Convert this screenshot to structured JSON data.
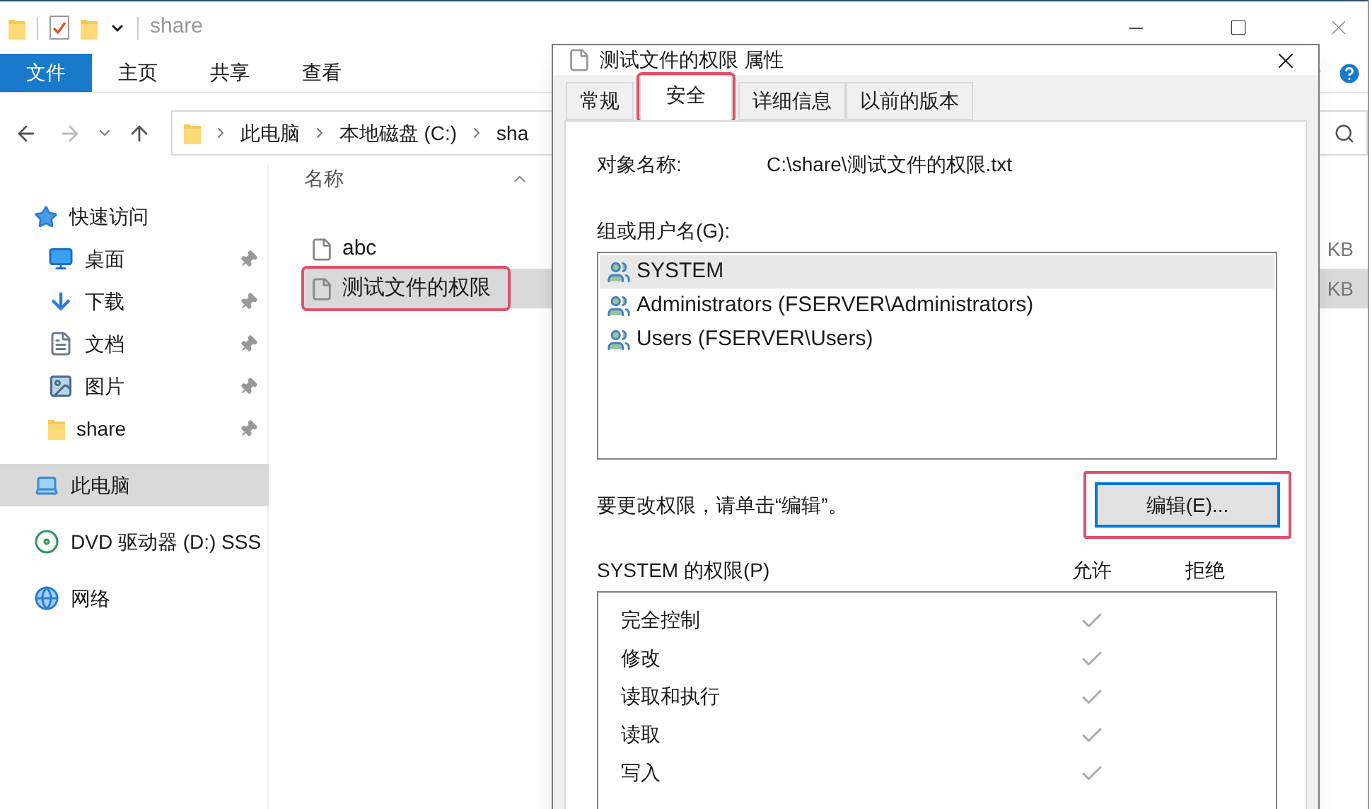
{
  "explorer": {
    "title": "share",
    "ribbon_tabs": [
      {
        "label": "文件",
        "selected": true
      },
      {
        "label": "主页",
        "selected": false
      },
      {
        "label": "共享",
        "selected": false
      },
      {
        "label": "查看",
        "selected": false
      }
    ],
    "breadcrumb": [
      "此电脑",
      "本地磁盘 (C:)",
      "sha"
    ],
    "sidebar": [
      {
        "label": "快速访问",
        "selected": false,
        "pinned": false,
        "children": [
          {
            "label": "桌面",
            "selected": false,
            "pinned": true
          },
          {
            "label": "下载",
            "selected": false,
            "pinned": true
          },
          {
            "label": "文档",
            "selected": false,
            "pinned": true
          },
          {
            "label": "图片",
            "selected": false,
            "pinned": true
          },
          {
            "label": "share",
            "selected": false,
            "pinned": true
          }
        ]
      },
      {
        "label": "此电脑",
        "selected": true,
        "pinned": false
      },
      {
        "label": "DVD 驱动器 (D:) SSS",
        "selected": false,
        "pinned": false
      },
      {
        "label": "网络",
        "selected": false,
        "pinned": false
      }
    ],
    "column_header": "名称",
    "files": [
      {
        "name": "abc",
        "size": "KB",
        "selected": false,
        "highlighted": false
      },
      {
        "name": "测试文件的权限",
        "size": "KB",
        "selected": true,
        "highlighted": true
      }
    ]
  },
  "dialog": {
    "title": "测试文件的权限 属性",
    "tabs": [
      {
        "label": "常规",
        "selected": false,
        "highlighted": false
      },
      {
        "label": "安全",
        "selected": true,
        "highlighted": true
      },
      {
        "label": "详细信息",
        "selected": false,
        "highlighted": false
      },
      {
        "label": "以前的版本",
        "selected": false,
        "highlighted": false
      }
    ],
    "object_name_label": "对象名称:",
    "object_name": "C:\\share\\测试文件的权限.txt",
    "groups_label": "组或用户名(G):",
    "groups": [
      {
        "name": "SYSTEM",
        "selected": true
      },
      {
        "name": "Administrators (FSERVER\\Administrators)",
        "selected": false
      },
      {
        "name": "Users (FSERVER\\Users)",
        "selected": false
      }
    ],
    "edit_hint": "要更改权限，请单击“编辑”。",
    "edit_button": {
      "label": "编辑(E)...",
      "highlighted": true
    },
    "permissions_label": "SYSTEM 的权限(P)",
    "allow_header": "允许",
    "deny_header": "拒绝",
    "permissions": [
      {
        "name": "完全控制",
        "allow": true,
        "deny": false
      },
      {
        "name": "修改",
        "allow": true,
        "deny": false
      },
      {
        "name": "读取和执行",
        "allow": true,
        "deny": false
      },
      {
        "name": "读取",
        "allow": true,
        "deny": false
      },
      {
        "name": "写入",
        "allow": true,
        "deny": false
      }
    ]
  }
}
